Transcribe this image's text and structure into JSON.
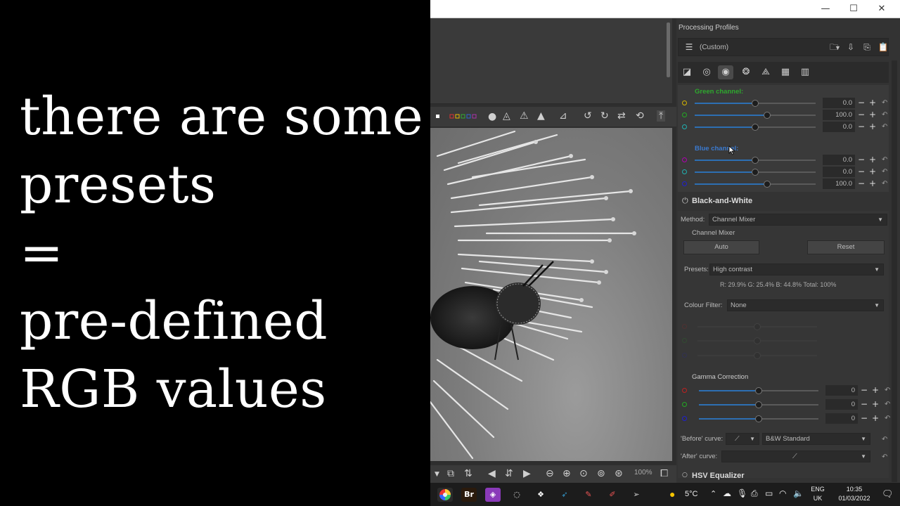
{
  "caption": {
    "line1": "there are some",
    "line2": "presets",
    "line3": "=",
    "line4": "pre-defined",
    "line5": "RGB values"
  },
  "window": {
    "minimize_glyph": "—",
    "maximize_glyph": "☐",
    "close_glyph": "✕"
  },
  "editor": {
    "zoom": "100%"
  },
  "profiles": {
    "title": "Processing Profiles",
    "selected": "(Custom)"
  },
  "mixer": {
    "green_channel_label": "Green channel:",
    "blue_channel_label": "Blue channel:",
    "green_rows": [
      {
        "value": "0.0",
        "fraction": 0.5,
        "color": "#d4b400"
      },
      {
        "value": "100.0",
        "fraction": 0.6,
        "color": "#22aa22"
      },
      {
        "value": "0.0",
        "fraction": 0.5,
        "color": "#20b0b0"
      }
    ],
    "blue_rows": [
      {
        "value": "0.0",
        "fraction": 0.5,
        "color": "#b000b0"
      },
      {
        "value": "0.0",
        "fraction": 0.5,
        "color": "#20b0b0"
      },
      {
        "value": "100.0",
        "fraction": 0.6,
        "color": "#2020d0"
      }
    ]
  },
  "bw": {
    "title": "Black-and-White",
    "method_label": "Method:",
    "method_value": "Channel Mixer",
    "subsection": "Channel Mixer",
    "auto_label": "Auto",
    "reset_label": "Reset",
    "presets_label": "Presets:",
    "presets_value": "High contrast",
    "stats": "R: 29.9%   G: 25.4%   B: 44.8%   Total: 100%",
    "filter_label": "Colour Filter:",
    "filter_value": "None",
    "gamma_title": "Gamma Correction",
    "gamma_rows": [
      {
        "value": "0",
        "fraction": 0.5,
        "color": "#c02020"
      },
      {
        "value": "0",
        "fraction": 0.5,
        "color": "#22aa22"
      },
      {
        "value": "0",
        "fraction": 0.5,
        "color": "#2020d0"
      }
    ],
    "before_curve_label": "'Before' curve:",
    "before_curve_value": "B&W Standard",
    "after_curve_label": "'After' curve:"
  },
  "hsv": {
    "title": "HSV Equalizer"
  },
  "taskbar": {
    "bridge_label": "Br",
    "temperature": "5°C",
    "lang1": "ENG",
    "lang2": "UK",
    "time": "10:35",
    "date": "01/03/2022"
  }
}
